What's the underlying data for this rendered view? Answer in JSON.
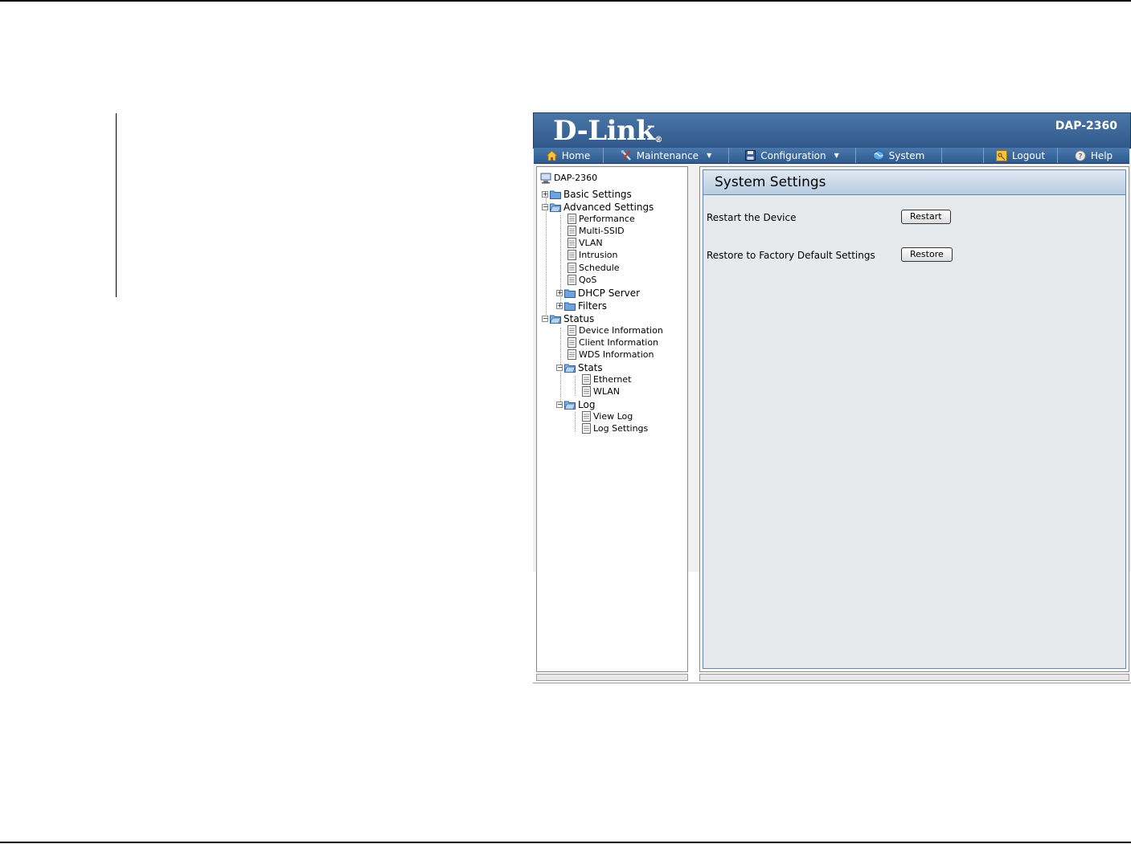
{
  "header": {
    "brand": "D-Link",
    "brand_mark": "®",
    "model": "DAP-2360"
  },
  "menu": {
    "items": [
      {
        "label": "Home",
        "icon": "home-icon"
      },
      {
        "label": "Maintenance",
        "icon": "tools-icon",
        "dropdown": true
      },
      {
        "label": "Configuration",
        "icon": "save-icon",
        "dropdown": true
      },
      {
        "label": "System",
        "icon": "globe-icon"
      },
      {
        "label": "Logout",
        "icon": "key-icon"
      },
      {
        "label": "Help",
        "icon": "help-icon"
      }
    ]
  },
  "tree": {
    "root": "DAP-2360",
    "basic_settings": "Basic Settings",
    "advanced_settings": "Advanced Settings",
    "advanced_items": [
      "Performance",
      "Multi-SSID",
      "VLAN",
      "Intrusion",
      "Schedule",
      "QoS"
    ],
    "dhcp_server": "DHCP Server",
    "filters": "Filters",
    "status": "Status",
    "status_items": [
      "Device Information",
      "Client Information",
      "WDS Information"
    ],
    "stats": "Stats",
    "stats_items": [
      "Ethernet",
      "WLAN"
    ],
    "log": "Log",
    "log_items": [
      "View Log",
      "Log Settings"
    ]
  },
  "content": {
    "title": "System Settings",
    "restart_label": "Restart the Device",
    "restart_button": "Restart",
    "restore_label": "Restore to Factory Default Settings",
    "restore_button": "Restore"
  },
  "colors": {
    "brand_blue": "#30598a",
    "menu_blue": "#2d5a8f",
    "panel_bg": "#e6eaed",
    "header_bg": "#b9cde1"
  }
}
